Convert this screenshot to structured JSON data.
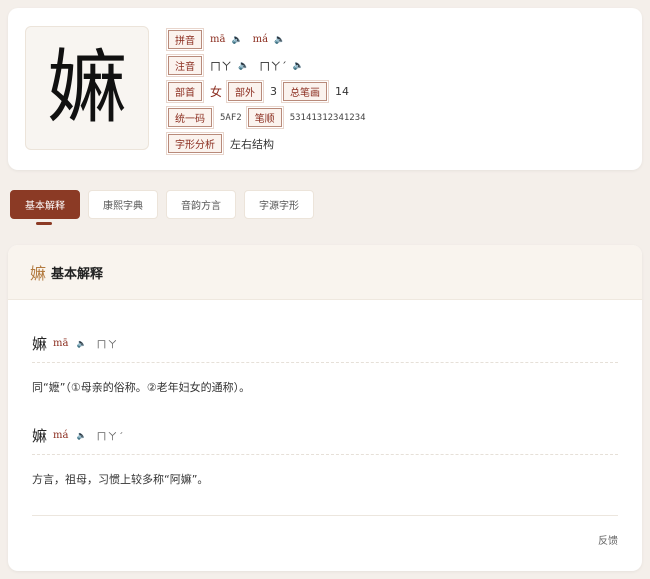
{
  "character": "嫲",
  "info": {
    "pinyin_label": "拼音",
    "pinyin": [
      "mā",
      "má"
    ],
    "zhuyin_label": "注音",
    "zhuyin": [
      "ㄇㄚ",
      "ㄇㄚˊ"
    ],
    "radical_label": "部首",
    "radical": "女",
    "strokes_outside_label": "部外",
    "strokes_outside": "3",
    "total_strokes_label": "总笔画",
    "total_strokes": "14",
    "unicode_label": "统一码",
    "unicode": "5AF2",
    "stroke_order_label": "笔顺",
    "stroke_order": "53141312341234",
    "structure_label": "字形分析",
    "structure": "左右结构",
    "speaker_glyph": "🔈"
  },
  "tabs": [
    {
      "label": "基本解释",
      "active": true
    },
    {
      "label": "康熙字典",
      "active": false
    },
    {
      "label": "音韵方言",
      "active": false
    },
    {
      "label": "字源字形",
      "active": false
    }
  ],
  "section": {
    "icon_char": "嫲",
    "title": "基本解释"
  },
  "entries": [
    {
      "char": "嫲",
      "pinyin": "mā",
      "zhuyin": "ㄇㄚ",
      "definition": "同“嬷”（①母亲的俗称。②老年妇女的通称）。"
    },
    {
      "char": "嫲",
      "pinyin": "má",
      "zhuyin": "ㄇㄚˊ",
      "definition": "方言，祖母，习惯上较多称“阿嫲”。"
    }
  ],
  "feedback_label": "反馈",
  "colors": {
    "accent": "#8b3a25",
    "background": "#f4efea",
    "gold": "#b2793e"
  }
}
